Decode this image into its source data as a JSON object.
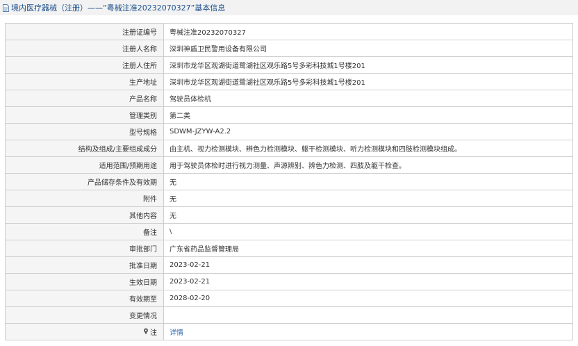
{
  "header": {
    "title": "境内医疗器械（注册）——“粤械注准20232070327”基本信息"
  },
  "rows": [
    {
      "label": "注册证编号",
      "value": "粤械注准20232070327"
    },
    {
      "label": "注册人名称",
      "value": "深圳神盾卫民警用设备有限公司"
    },
    {
      "label": "注册人住所",
      "value": "深圳市龙华区观湖街道鹭湖社区观乐路5号多彩科技城1号楼201"
    },
    {
      "label": "生产地址",
      "value": "深圳市龙华区观湖街道鹭湖社区观乐路5号多彩科技城1号楼201"
    },
    {
      "label": "产品名称",
      "value": "驾驶员体检机"
    },
    {
      "label": "管理类别",
      "value": "第二类"
    },
    {
      "label": "型号规格",
      "value": "SDWM-JZYW-A2.2"
    },
    {
      "label": "结构及组成/主要组成成分",
      "value": "由主机、视力检测模块、辨色力检测模块、躯干检测模块、听力检测模块和四肢检测模块组成。"
    },
    {
      "label": "适用范围/预期用途",
      "value": "用于驾驶员体检时进行视力测量、声源辨别、辨色力检测、四肢及躯干检查。"
    },
    {
      "label": "产品储存条件及有效期",
      "value": "无"
    },
    {
      "label": "附件",
      "value": "无"
    },
    {
      "label": "其他内容",
      "value": "无"
    },
    {
      "label": "备注",
      "value": "\\"
    },
    {
      "label": "审批部门",
      "value": "广东省药品监督管理局"
    },
    {
      "label": "批准日期",
      "value": "2023-02-21"
    },
    {
      "label": "生效日期",
      "value": "2023-02-21"
    },
    {
      "label": "有效期至",
      "value": "2028-02-20"
    },
    {
      "label": "变更情况",
      "value": ""
    }
  ],
  "note_row": {
    "label": "注",
    "icon": "pin-icon",
    "link_text": "详情"
  }
}
